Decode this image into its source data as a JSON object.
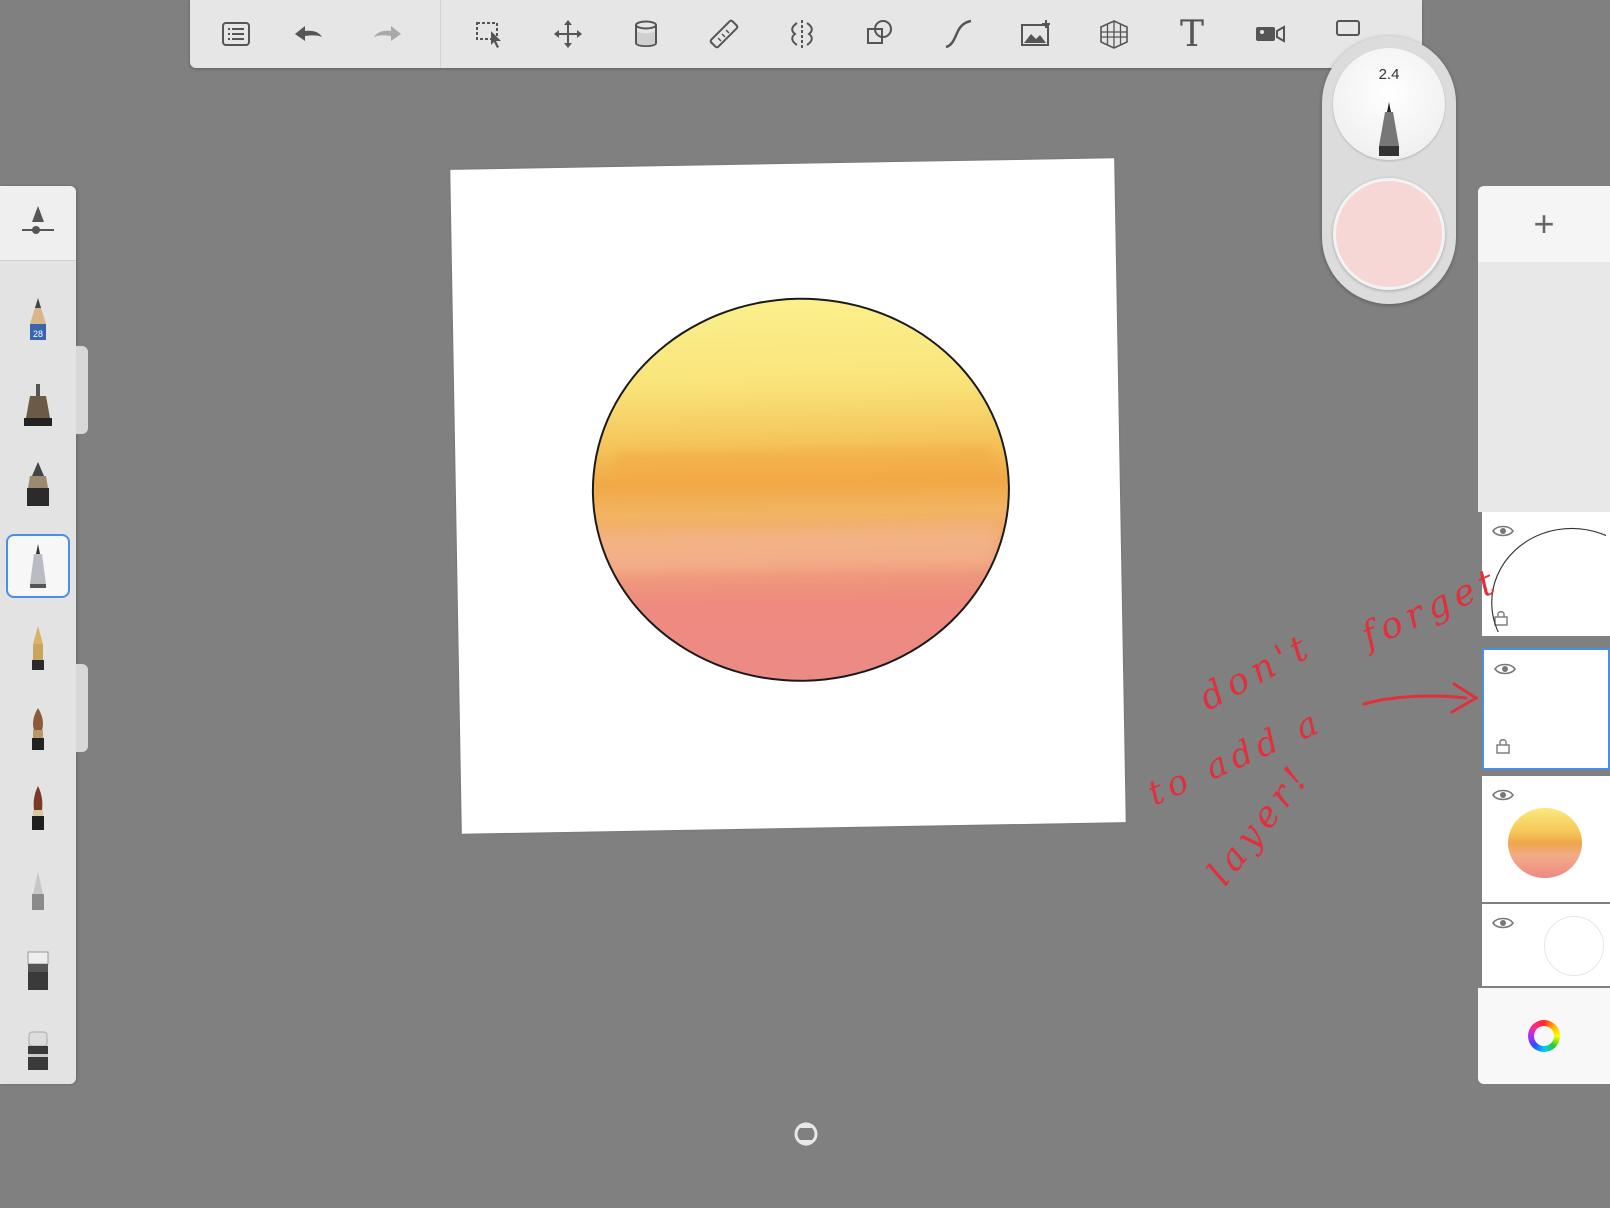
{
  "toolbar": {
    "tools": [
      {
        "name": "menu-list-icon"
      },
      {
        "name": "undo-icon"
      },
      {
        "name": "redo-icon"
      },
      {
        "name": "selection-icon"
      },
      {
        "name": "transform-move-icon"
      },
      {
        "name": "fill-bucket-icon"
      },
      {
        "name": "ruler-icon"
      },
      {
        "name": "symmetry-icon"
      },
      {
        "name": "shapes-icon"
      },
      {
        "name": "stroke-curve-icon"
      },
      {
        "name": "add-image-icon"
      },
      {
        "name": "perspective-grid-icon"
      },
      {
        "name": "text-tool-icon"
      },
      {
        "name": "timelapse-camera-icon"
      }
    ],
    "text_tool_label": "T"
  },
  "brushes": {
    "items": [
      {
        "name": "pencil"
      },
      {
        "name": "ink-pen"
      },
      {
        "name": "marker"
      },
      {
        "name": "fineliner"
      },
      {
        "name": "fountain-pen"
      },
      {
        "name": "paint-brush"
      },
      {
        "name": "soft-brush"
      },
      {
        "name": "airbrush"
      },
      {
        "name": "smudge"
      },
      {
        "name": "eraser"
      }
    ],
    "pencil_badge": "28",
    "selected_index": 3
  },
  "brush_puck": {
    "size_value": "2.4",
    "color": "#f7d6d6"
  },
  "layers": {
    "add_label": "+",
    "items": [
      {
        "name": "layer-outline"
      },
      {
        "name": "layer-empty",
        "selected": true
      },
      {
        "name": "layer-sun-gradient"
      },
      {
        "name": "layer-background"
      }
    ]
  },
  "annotation": {
    "lines": [
      "forget",
      "don't",
      "to add a",
      "layer!"
    ],
    "color": "#e0303c"
  },
  "colors": {
    "background": "#808080",
    "accent": "#4a8fe7"
  }
}
